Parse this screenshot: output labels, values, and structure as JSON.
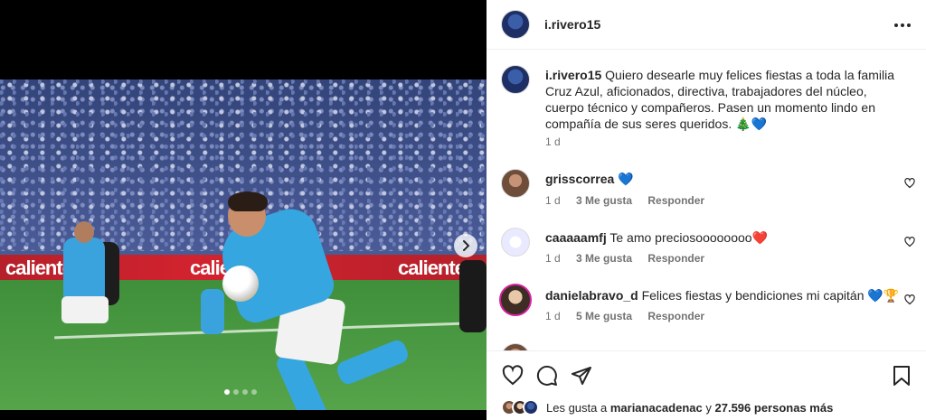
{
  "post": {
    "username": "i.rivero15",
    "caption_username": "i.rivero15",
    "caption_text": "Quiero desearle muy felices fiestas a toda la familia Cruz Azul, aficionados, directiva, trabajadores del núcleo, cuerpo técnico y compañeros. Pasen un momento lindo en compañía de sus seres queridos. 🎄💙",
    "caption_time": "1 d",
    "carousel": {
      "total": 4,
      "active": 0
    },
    "ad_text": "caliente"
  },
  "comments": [
    {
      "username": "grisscorrea",
      "text": "💙",
      "time": "1 d",
      "likes": "3 Me gusta",
      "reply": "Responder"
    },
    {
      "username": "caaaaamfj",
      "text": "Te amo preciosoooooooo❤️",
      "time": "1 d",
      "likes": "3 Me gusta",
      "reply": "Responder"
    },
    {
      "username": "danielabravo_d",
      "text": "Felices fiestas y bendiciones mi capitán 💙🏆",
      "time": "1 d",
      "likes": "5 Me gusta",
      "reply": "Responder"
    }
  ],
  "likes_bar": {
    "prefix": "Les gusta a",
    "user": "marianacadenac",
    "connector": "y",
    "count": "27.596 personas más"
  },
  "icons": {
    "more": "more-horizontal-icon",
    "like": "heart-icon",
    "comment": "comment-icon",
    "share": "paper-plane-icon",
    "save": "bookmark-icon",
    "next": "chevron-right-icon"
  }
}
